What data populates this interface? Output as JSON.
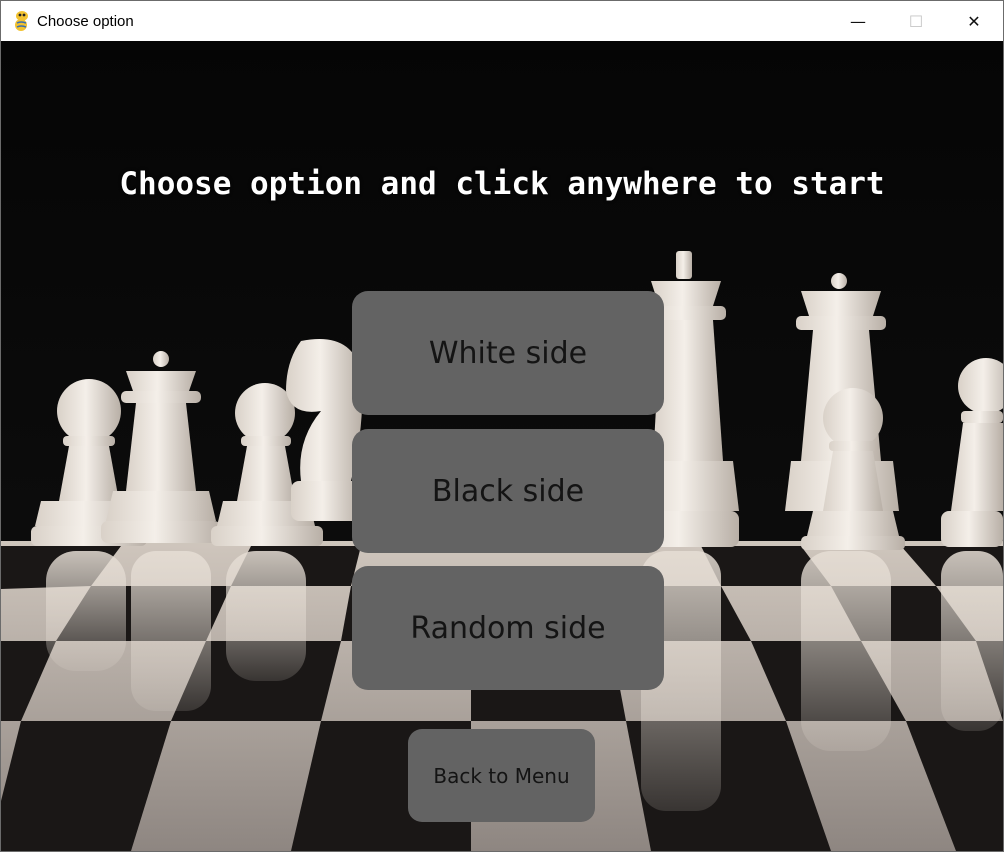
{
  "window": {
    "title": "Choose option",
    "app_icon": "python-snake-icon",
    "controls": {
      "minimize": "—",
      "maximize": "☐",
      "close": "✕"
    }
  },
  "game": {
    "headline": "Choose option and click anywhere to start",
    "options": [
      {
        "label": "White side"
      },
      {
        "label": "Black side"
      },
      {
        "label": "Random side"
      }
    ],
    "back_label": "Back to Menu",
    "background": "chess-pieces-photo"
  },
  "colors": {
    "button": "#636363",
    "button_text": "#141414",
    "headline": "#ffffff",
    "background": "#070707"
  }
}
